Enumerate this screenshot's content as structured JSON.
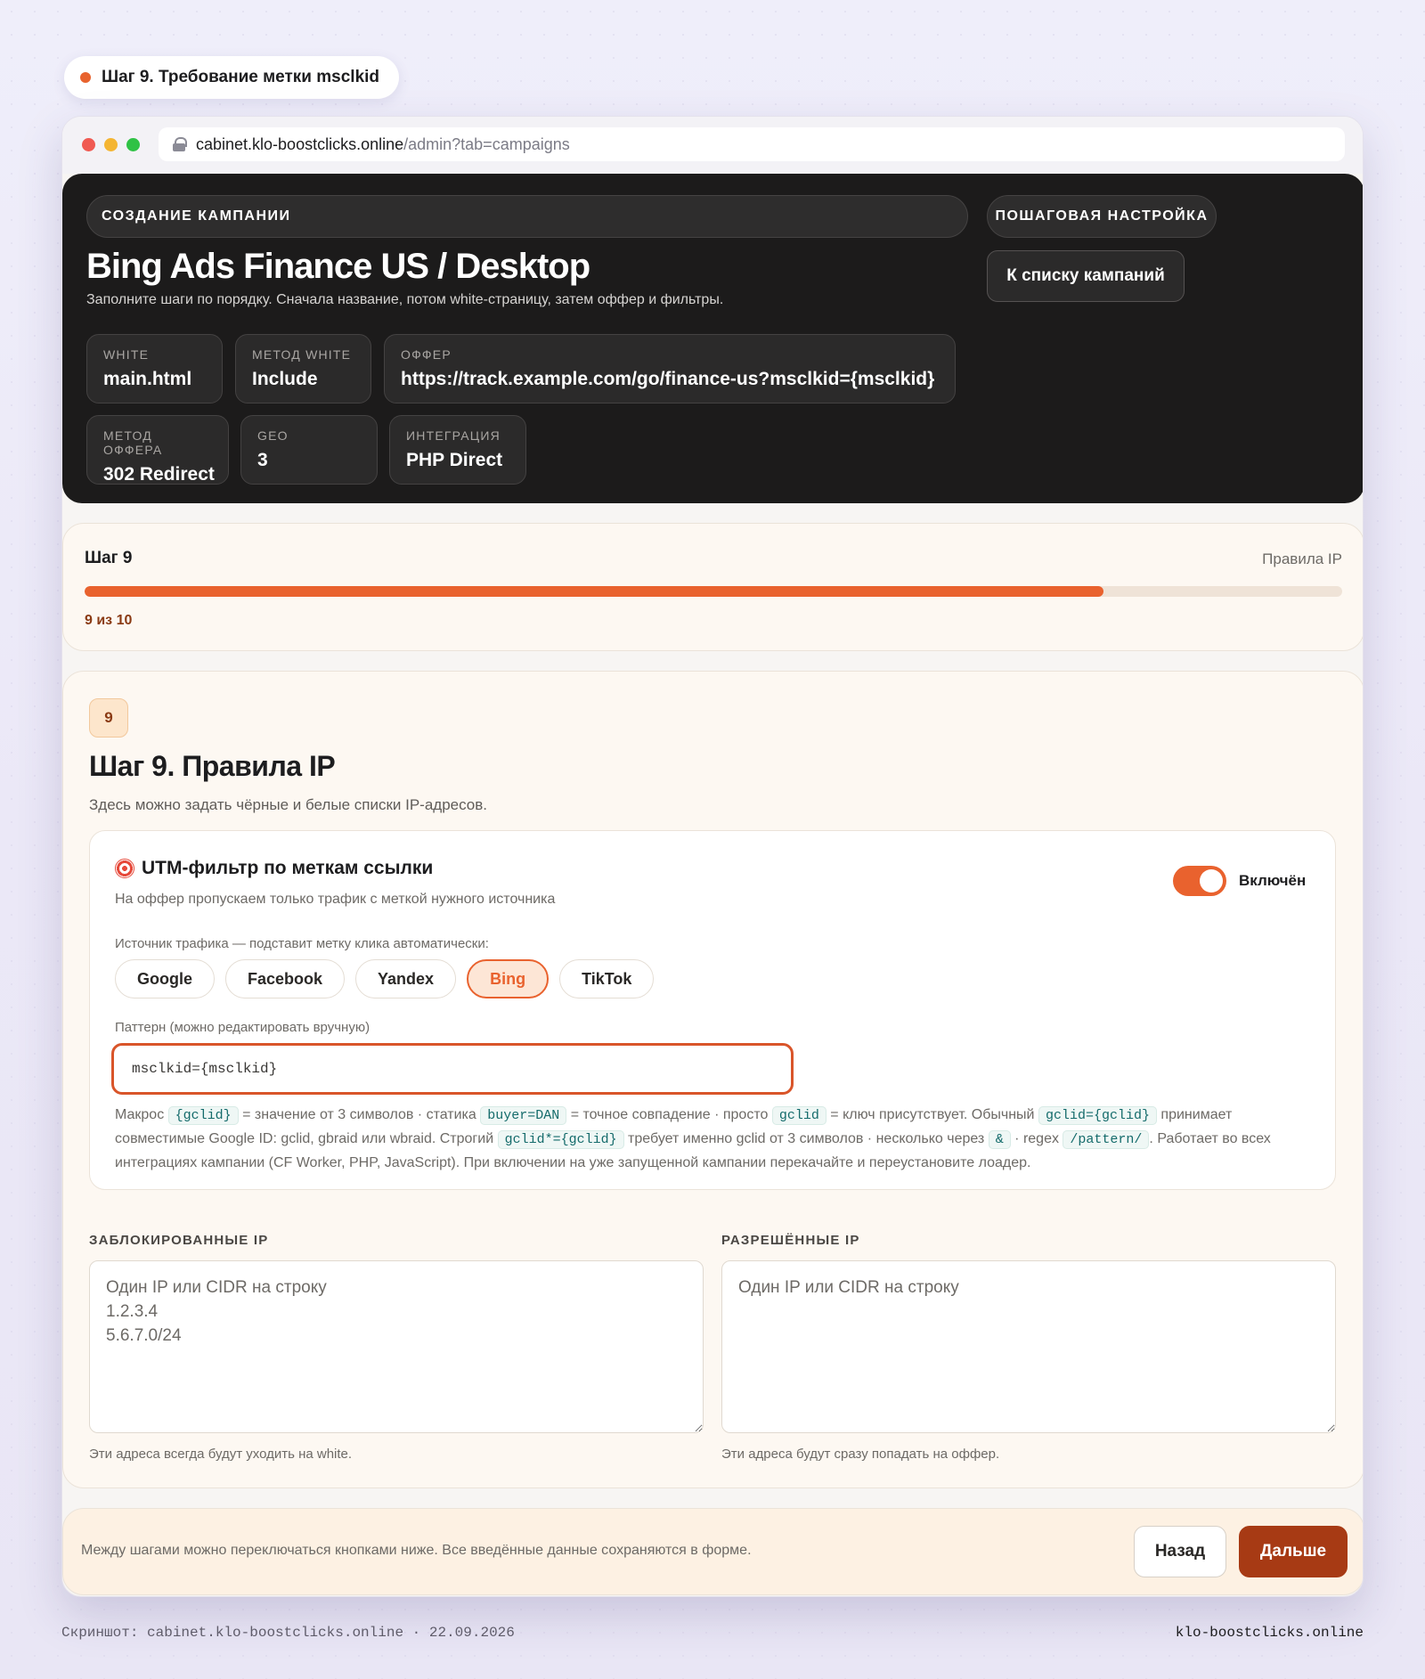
{
  "step_pill": {
    "label": "Шаг 9. Требование метки msclkid"
  },
  "browser": {
    "url_host": "cabinet.klo-boostclicks.online",
    "url_path": "/admin?tab=campaigns"
  },
  "hero": {
    "section_label": "СОЗДАНИЕ КАМПАНИИ",
    "title": "Bing Ads Finance US / Desktop",
    "subtitle": "Заполните шаги по порядку. Сначала название, потом white-страницу, затем оффер и фильтры.",
    "right_label": "ПОШАГОВАЯ НАСТРОЙКА",
    "back_button": "К списку кампаний",
    "chips": [
      {
        "key": "WHITE",
        "value": "main.html"
      },
      {
        "key": "МЕТОД WHITE",
        "value": "Include"
      },
      {
        "key": "ОФФЕР",
        "value": "https://track.example.com/go/finance-us?msclkid={msclkid}"
      },
      {
        "key": "МЕТОД ОФФЕРА",
        "value": "302 Redirect"
      },
      {
        "key": "GEO",
        "value": "3"
      },
      {
        "key": "ИНТЕГРАЦИЯ",
        "value": "PHP Direct"
      }
    ]
  },
  "progress": {
    "step_label": "Шаг 9",
    "step_name": "Правила IP",
    "count": "9 из 10",
    "current": 9,
    "total": 10
  },
  "step": {
    "number": "9",
    "title": "Шаг 9. Правила IP",
    "subtitle": "Здесь можно задать чёрные и белые списки IP-адресов."
  },
  "utm": {
    "title": "UTM-фильтр по меткам ссылки",
    "icon": "target-icon",
    "subtitle": "На оффер пропускаем только трафик с меткой нужного источника",
    "toggle_label": "Включён",
    "enabled": true,
    "source_label": "Источник трафика — подставит метку клика автоматически:",
    "sources": [
      "Google",
      "Facebook",
      "Yandex",
      "Bing",
      "TikTok"
    ],
    "active_source": "Bing",
    "pattern_label": "Паттерн (можно редактировать вручную)",
    "pattern_value": "msclkid={msclkid}",
    "help": {
      "t1": "Макрос ",
      "c1": "{gclid}",
      "t2": " = значение от 3 символов · статика ",
      "c2": "buyer=DAN",
      "t3": " = точное совпадение · просто ",
      "c3": "gclid",
      "t4": " = ключ присутствует. Обычный ",
      "c4": "gclid={gclid}",
      "t5": " принимает совместимые Google ID: gclid, gbraid или wbraid. Строгий ",
      "c5": "gclid*={gclid}",
      "t6": " требует именно gclid от 3 символов · несколько через ",
      "c6": "&",
      "t7": " · regex ",
      "c7": "/pattern/",
      "t8": ". Работает во всех интеграциях кампании (CF Worker, PHP, JavaScript). При включении на уже запущенной кампании перекачайте и переустановите лоадер."
    }
  },
  "ip": {
    "blocked": {
      "label": "ЗАБЛОКИРОВАННЫЕ IP",
      "placeholder": "Один IP или CIDR на строку\n1.2.3.4\n5.6.7.0/24",
      "hint": "Эти адреса всегда будут уходить на white."
    },
    "allowed": {
      "label": "РАЗРЕШЁННЫЕ IP",
      "placeholder": "Один IP или CIDR на строку",
      "hint": "Эти адреса будут сразу попадать на оффер."
    }
  },
  "footer": {
    "text": "Между шагами можно переключаться кнопками ниже. Все введённые данные сохраняются в форме.",
    "back": "Назад",
    "next": "Дальше"
  },
  "caption": {
    "left": "Скриншот: cabinet.klo-boostclicks.online · 22.09.2026",
    "right": "klo-boostclicks.online"
  },
  "colors": {
    "accent": "#e9622e",
    "next_button": "#a73a14",
    "hero_bg": "#1c1b1b"
  }
}
